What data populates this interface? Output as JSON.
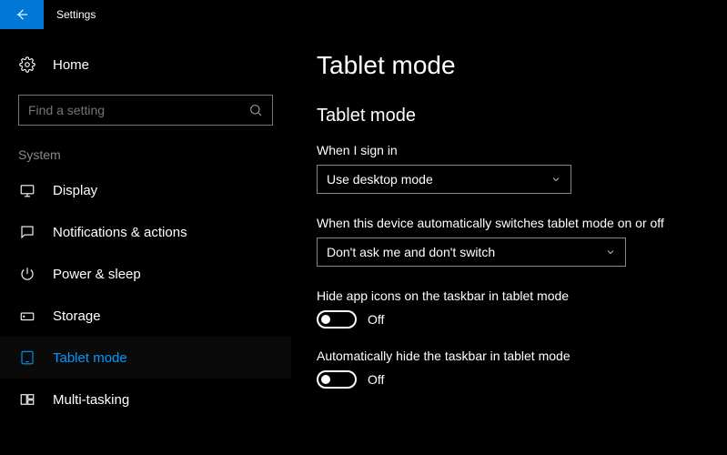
{
  "titlebar": {
    "title": "Settings"
  },
  "sidebar": {
    "home_label": "Home",
    "search_placeholder": "Find a setting",
    "section_label": "System",
    "items": [
      {
        "label": "Display"
      },
      {
        "label": "Notifications & actions"
      },
      {
        "label": "Power & sleep"
      },
      {
        "label": "Storage"
      },
      {
        "label": "Tablet mode"
      },
      {
        "label": "Multi-tasking"
      }
    ]
  },
  "main": {
    "page_title": "Tablet mode",
    "subheading": "Tablet mode",
    "signin": {
      "label": "When I sign in",
      "value": "Use desktop mode"
    },
    "autoswitch": {
      "label": "When this device automatically switches tablet mode on or off",
      "value": "Don't ask me and don't switch"
    },
    "hide_icons": {
      "label": "Hide app icons on the taskbar in tablet mode",
      "state": "Off"
    },
    "hide_taskbar": {
      "label": "Automatically hide the taskbar in tablet mode",
      "state": "Off"
    }
  }
}
